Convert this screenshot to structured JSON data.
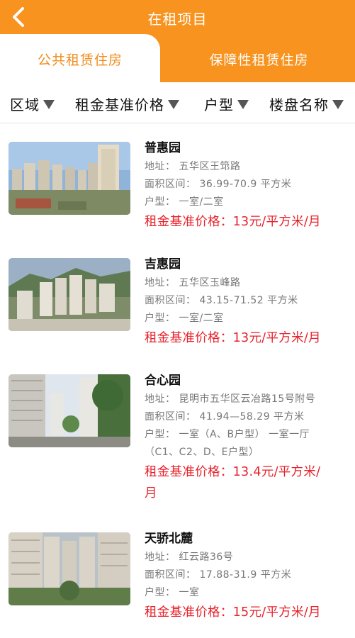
{
  "header": {
    "title": "在租项目",
    "back_icon": "chevron-left-icon"
  },
  "tabs": [
    {
      "label": "公共租赁住房",
      "active": true
    },
    {
      "label": "保障性租赁住房",
      "active": false
    }
  ],
  "filters": [
    {
      "label": "区域"
    },
    {
      "label": "租金基准价格"
    },
    {
      "label": "户型"
    },
    {
      "label": "楼盘名称"
    }
  ],
  "listings": [
    {
      "name": "普惠园",
      "address": "地址：  五华区王筇路",
      "area": "面积区间：  36.99-70.9 平方米",
      "type_lines": [
        "户型：  一室/二室"
      ],
      "price_lines": [
        "租金基准价格：13元/平方米/月"
      ]
    },
    {
      "name": "吉惠园",
      "address": "地址：  五华区玉峰路",
      "area": "面积区间：  43.15-71.52 平方米",
      "type_lines": [
        "户型：  一室/二室"
      ],
      "price_lines": [
        "租金基准价格：13元/平方米/月"
      ]
    },
    {
      "name": "合心园",
      "address": "地址：  昆明市五华区云冶路15号附号",
      "area": "面积区间：  41.94—58.29 平方米",
      "type_lines": [
        "户型：  一室（A、B户型）  一室一厅",
        "（C1、C2、D、E户型）"
      ],
      "price_lines": [
        "租金基准价格：13.4元/平方米/",
        "月"
      ]
    },
    {
      "name": "天骄北麓",
      "address": "地址：  红云路36号",
      "area": "面积区间：  17.88-31.9 平方米",
      "type_lines": [
        "户型：  一室"
      ],
      "price_lines": [
        "租金基准价格：15元/平方米/月"
      ]
    }
  ],
  "colors": {
    "accent": "#f7931e",
    "price": "#e8212a"
  }
}
